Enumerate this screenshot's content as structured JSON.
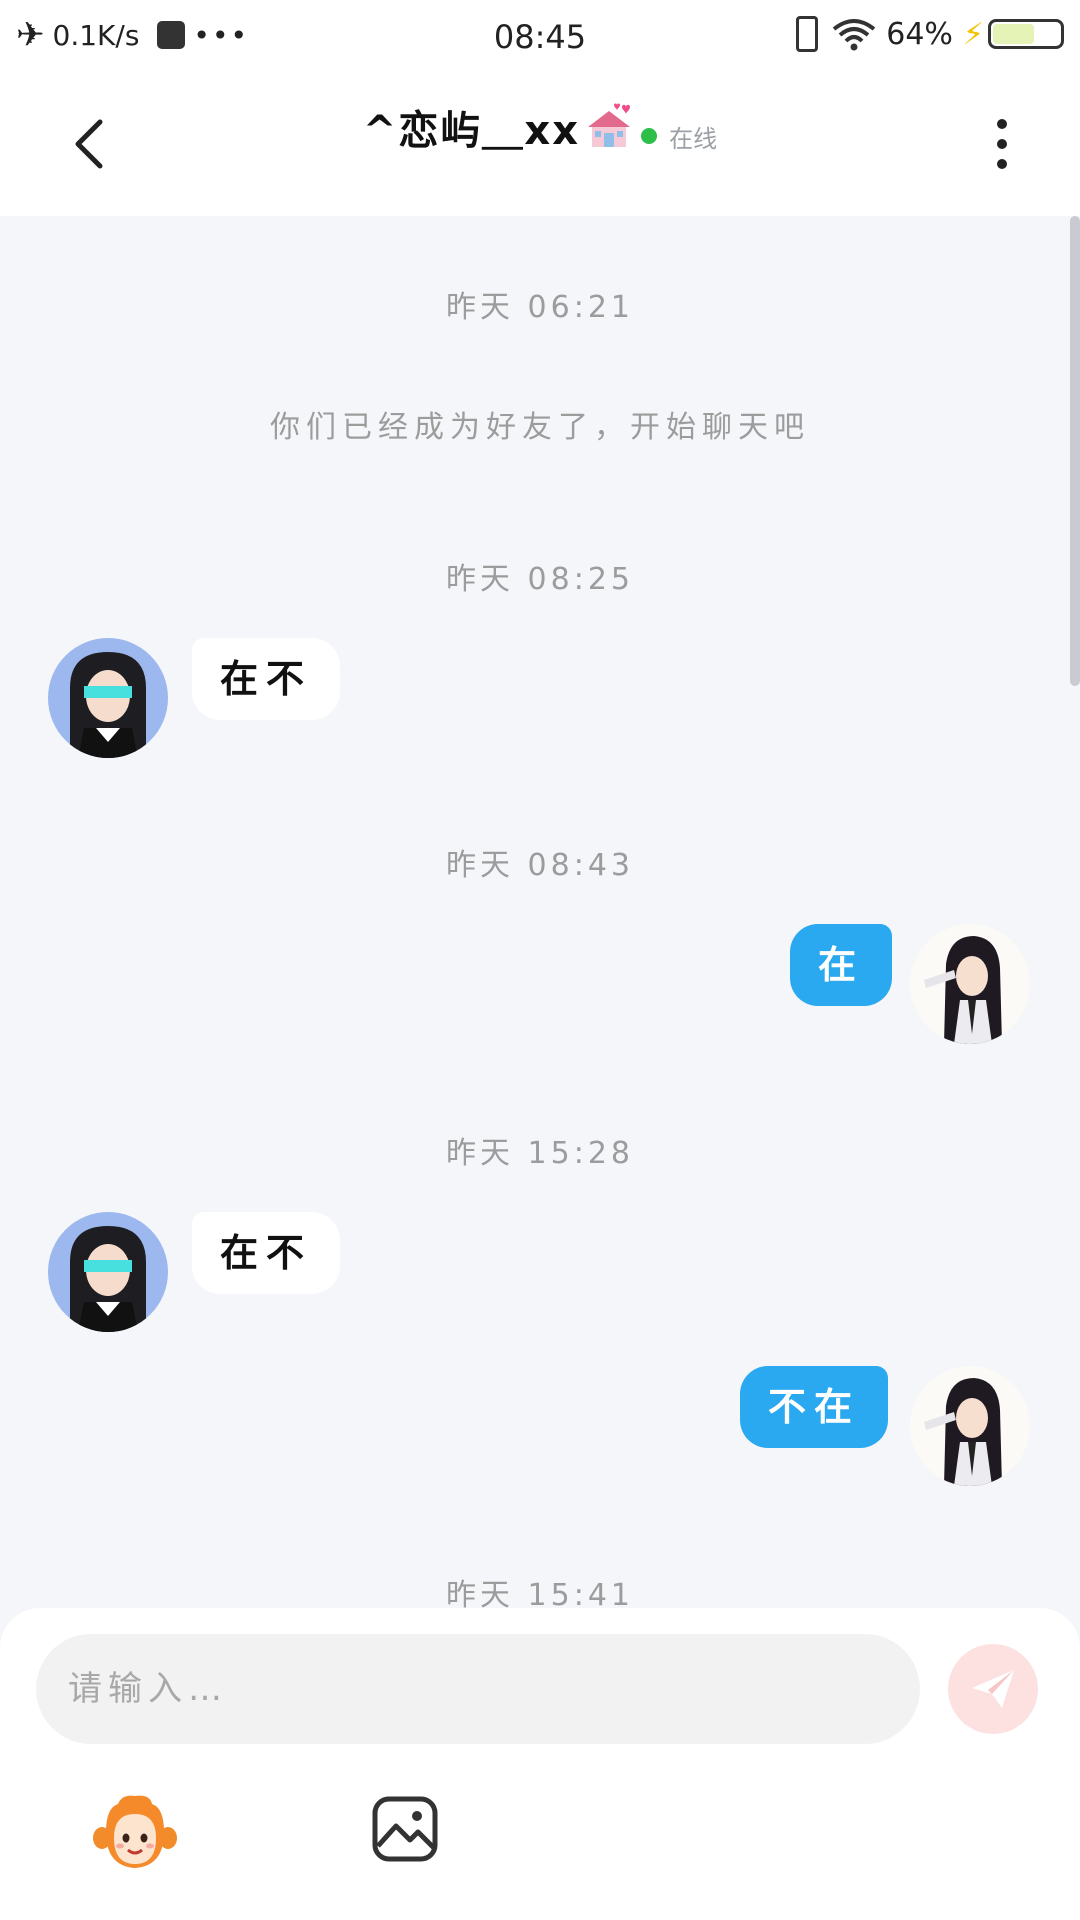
{
  "status_bar": {
    "net_speed": "0.1K/s",
    "time": "08:45",
    "battery": "64%",
    "battery_level": 0.64
  },
  "header": {
    "title": "^恋屿＿xx",
    "status": "在线"
  },
  "messages": [
    {
      "type": "time",
      "text": "昨天 06:21"
    },
    {
      "type": "system",
      "text": "你们已经成为好友了，开始聊天吧"
    },
    {
      "type": "time",
      "text": "昨天 08:25"
    },
    {
      "type": "incoming",
      "text": "在不"
    },
    {
      "type": "time",
      "text": "昨天 08:43"
    },
    {
      "type": "outgoing",
      "text": "在"
    },
    {
      "type": "time",
      "text": "昨天 15:28"
    },
    {
      "type": "incoming",
      "text": "在不"
    },
    {
      "type": "outgoing",
      "text": "不在"
    },
    {
      "type": "time",
      "text": "昨天 15:41"
    }
  ],
  "input": {
    "placeholder": "请输入…"
  },
  "colors": {
    "accent": "#2aa8f0",
    "online": "#2dbf4a",
    "send_disabled": "#fde1e1"
  }
}
